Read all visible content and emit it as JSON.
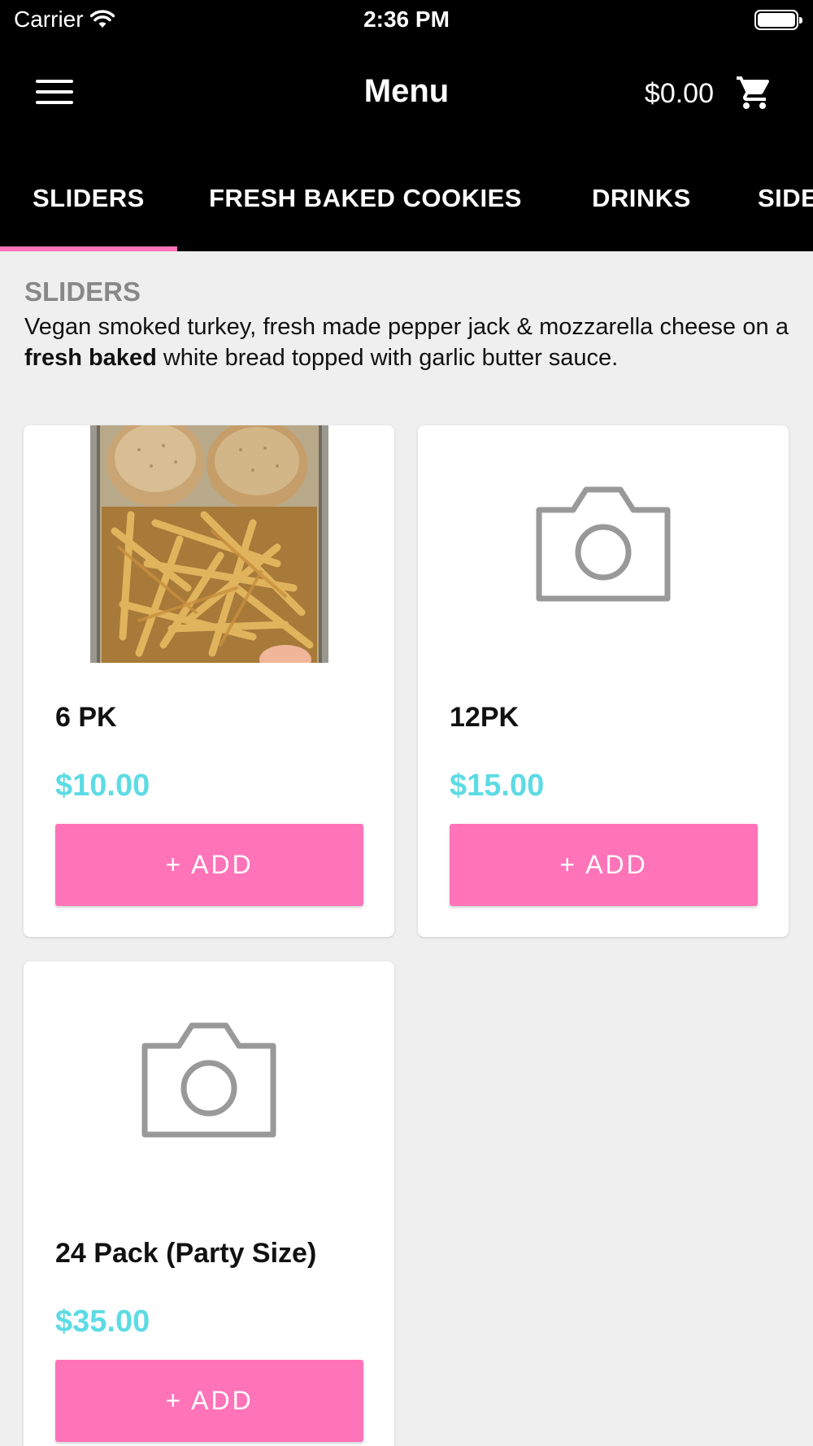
{
  "status_bar": {
    "carrier": "Carrier",
    "time": "2:36 PM"
  },
  "header": {
    "title": "Menu",
    "cart_total": "$0.00"
  },
  "tabs": [
    {
      "label": "SLIDERS",
      "active": true
    },
    {
      "label": "FRESH BAKED COOKIES",
      "active": false
    },
    {
      "label": "DRINKS",
      "active": false
    },
    {
      "label": "SIDES",
      "active": false
    }
  ],
  "category": {
    "title": "SLIDERS",
    "description_before": "Vegan smoked turkey, fresh made pepper jack & mozzarella cheese on a ",
    "description_bold": "fresh baked",
    "description_after": " white bread topped with garlic butter sauce."
  },
  "products": [
    {
      "name": "6 PK",
      "price": "$10.00",
      "add_label": "+ ADD",
      "image": "food-photo"
    },
    {
      "name": "12PK",
      "price": "$15.00",
      "add_label": "+ ADD",
      "image": "camera-placeholder-icon"
    },
    {
      "name": "24 Pack (Party Size)",
      "price": "$35.00",
      "add_label": "+ ADD",
      "image": "camera-placeholder-icon"
    }
  ],
  "colors": {
    "accent": "#ff73b9",
    "price": "#5ddbe4",
    "header_bg": "#000000",
    "page_bg": "#efefef",
    "category_title": "#888888"
  }
}
